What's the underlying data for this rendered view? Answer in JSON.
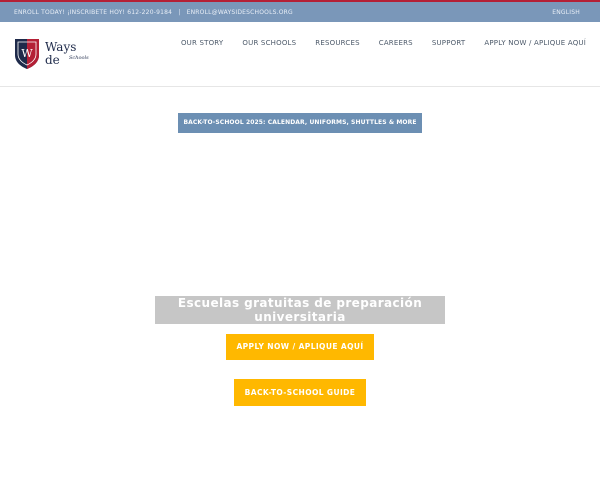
{
  "topbar": {
    "enroll_text": "ENROLL TODAY! ¡INSCRIBETE HOY! 612-220-9184",
    "separator": "|",
    "email": "ENROLL@WAYSIDESCHOOLS.ORG",
    "language": "ENGLISH",
    "accent_color": "#b42036"
  },
  "logo": {
    "brand_name": "Ways de",
    "brand_sub": "Schools",
    "shield_letter": "W"
  },
  "nav": {
    "items": [
      {
        "label": "OUR STORY"
      },
      {
        "label": "OUR SCHOOLS"
      },
      {
        "label": "RESOURCES"
      },
      {
        "label": "CAREERS"
      },
      {
        "label": "SUPPORT"
      },
      {
        "label": "APPLY NOW / APLIQUE AQUÍ"
      }
    ]
  },
  "banner": {
    "label": "BACK-TO-SCHOOL 2025: CALENDAR, UNIFORMS, SHUTTLES & MORE",
    "color": "#6c8fb3"
  },
  "hero": {
    "title": "Escuelas gratuitas de preparación universitaria",
    "apply_label": "APPLY NOW / APLIQUE AQUÍ",
    "guide_label": "BACK-TO-SCHOOL GUIDE",
    "button_color": "#ffb800"
  }
}
